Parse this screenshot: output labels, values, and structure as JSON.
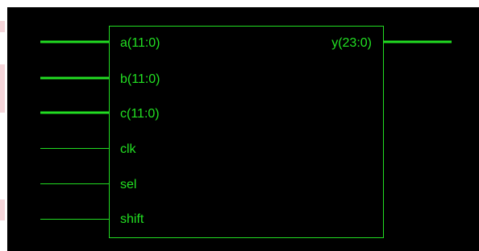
{
  "schematic": {
    "colors": {
      "background": "#000000",
      "wire": "#22dd22",
      "text": "#22e022"
    },
    "inputs": [
      {
        "label": "a(11:0)",
        "bus": true
      },
      {
        "label": "b(11:0)",
        "bus": true
      },
      {
        "label": "c(11:0)",
        "bus": true
      },
      {
        "label": "clk",
        "bus": false
      },
      {
        "label": "sel",
        "bus": false
      },
      {
        "label": "shift",
        "bus": false
      }
    ],
    "outputs": [
      {
        "label": "y(23:0)",
        "bus": true
      }
    ]
  }
}
